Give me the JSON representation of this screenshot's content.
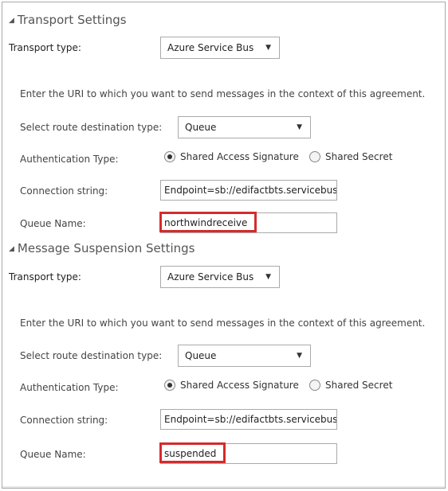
{
  "sections": [
    {
      "title": "Transport Settings",
      "transport_type_label": "Transport type:",
      "transport_type_value": "Azure Service Bus",
      "description": "Enter the URI to which you want to send messages in the context of this agreement.",
      "route_label": "Select route destination type:",
      "route_value": "Queue",
      "auth_label": "Authentication Type:",
      "auth_options": [
        "Shared Access Signature",
        "Shared Secret"
      ],
      "auth_selected": "Shared Access Signature",
      "connection_label": "Connection string:",
      "connection_value": "Endpoint=sb://edifactbts.servicebus",
      "queue_label": "Queue Name:",
      "queue_value": "northwindreceive"
    },
    {
      "title": "Message Suspension Settings",
      "transport_type_label": "Transport type:",
      "transport_type_value": "Azure Service Bus",
      "description": "Enter the URI to which you want to send messages in the context of this agreement.",
      "route_label": "Select route destination type:",
      "route_value": "Queue",
      "auth_label": "Authentication Type:",
      "auth_options": [
        "Shared Access Signature",
        "Shared Secret"
      ],
      "auth_selected": "Shared Access Signature",
      "connection_label": "Connection string:",
      "connection_value": "Endpoint=sb://edifactbts.servicebus",
      "queue_label": "Queue Name:",
      "queue_value": "suspended"
    }
  ],
  "colors": {
    "highlight": "#d42b2b",
    "border": "#aaaaaa"
  },
  "icons": {
    "collapse": "triangle-collapse-icon",
    "dropdown": "chevron-down-icon",
    "radio": "radio-icon"
  }
}
